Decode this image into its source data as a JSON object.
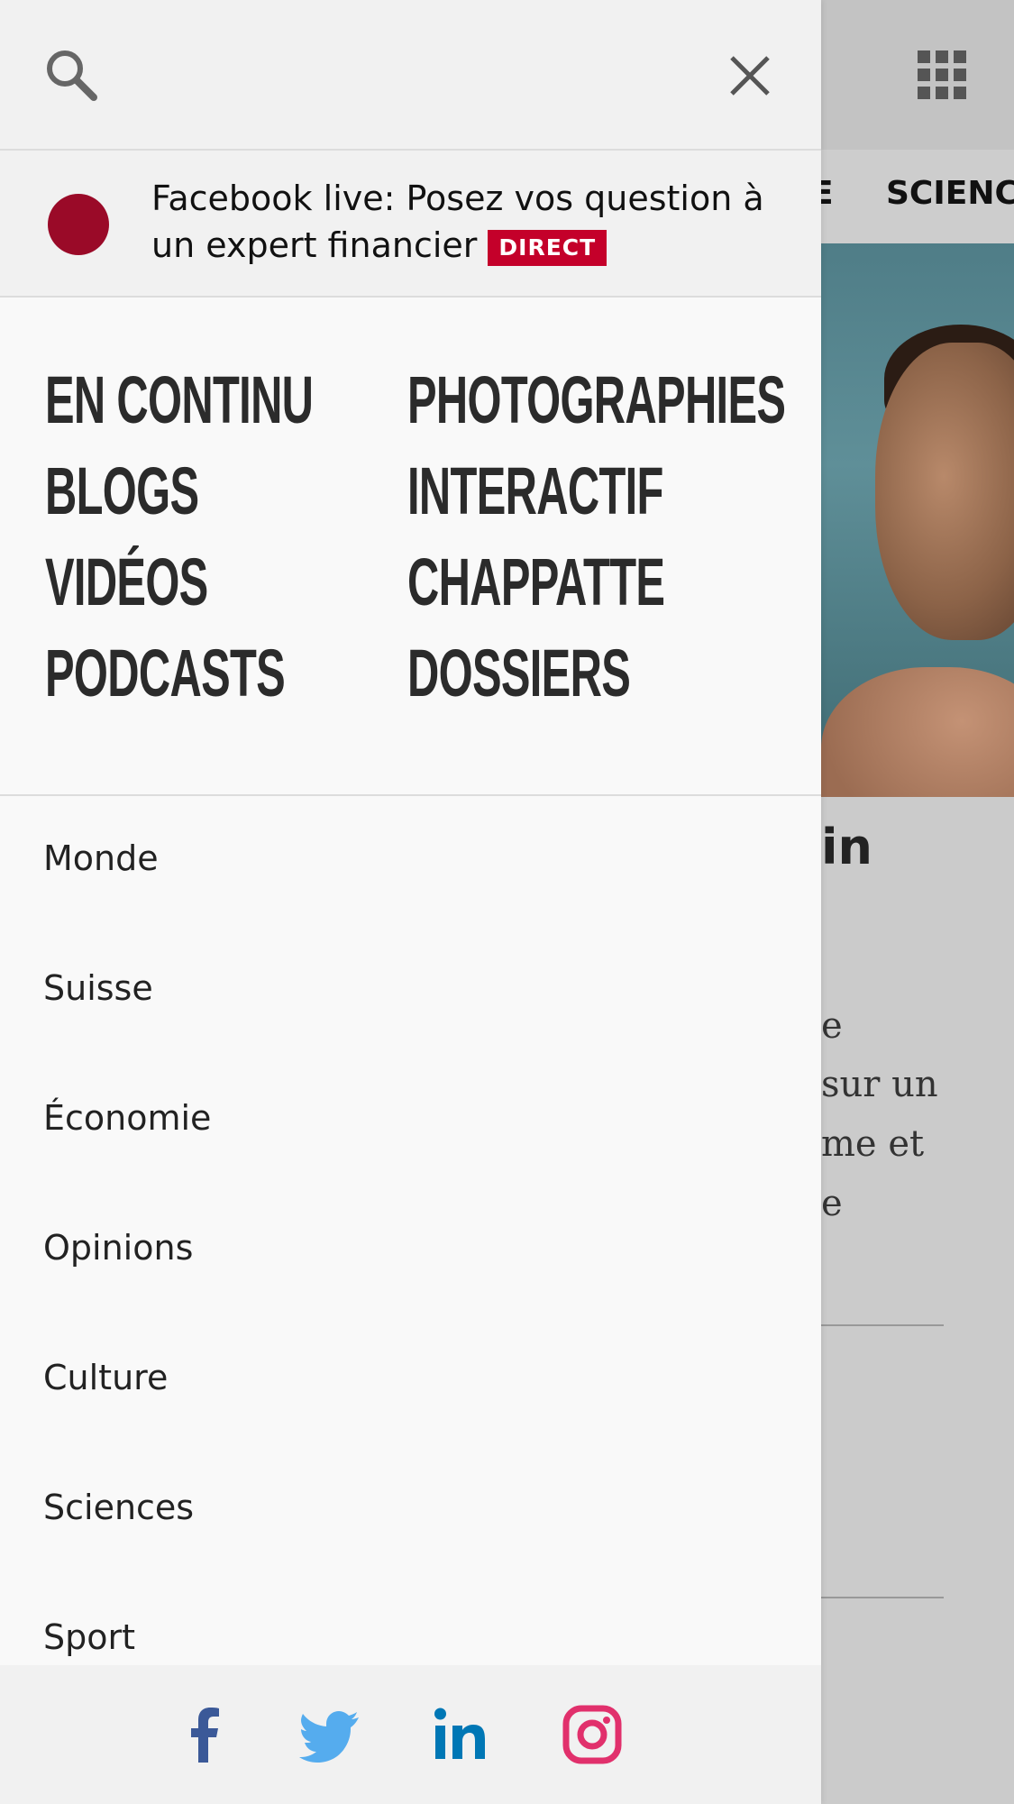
{
  "background_page": {
    "tabs": [
      "E",
      "SCIENC"
    ],
    "headline_fragment": "in",
    "teaser_lines": [
      "e",
      "sur un",
      "me et",
      "e"
    ]
  },
  "drawer": {
    "live": {
      "text": "Facebook live: Posez vos question à un expert financier",
      "badge": "DIRECT"
    },
    "big_links": [
      "EN CONTINU",
      "BLOGS",
      "VIDÉOS",
      "PODCASTS",
      "PHOTOGRAPHIES",
      "INTERACTIF",
      "CHAPPATTE",
      "DOSSIERS"
    ],
    "sections": [
      "Monde",
      "Suisse",
      "Économie",
      "Opinions",
      "Culture",
      "Sciences",
      "Sport"
    ],
    "social": [
      {
        "icon": "facebook-icon",
        "color": "#3b5998"
      },
      {
        "icon": "twitter-icon",
        "color": "#55acee"
      },
      {
        "icon": "linkedin-icon",
        "color": "#0077b5"
      },
      {
        "icon": "instagram-icon",
        "color": "#e1306c"
      }
    ]
  },
  "colors": {
    "live_dot": "#9a0a28",
    "badge": "#c4002a"
  }
}
